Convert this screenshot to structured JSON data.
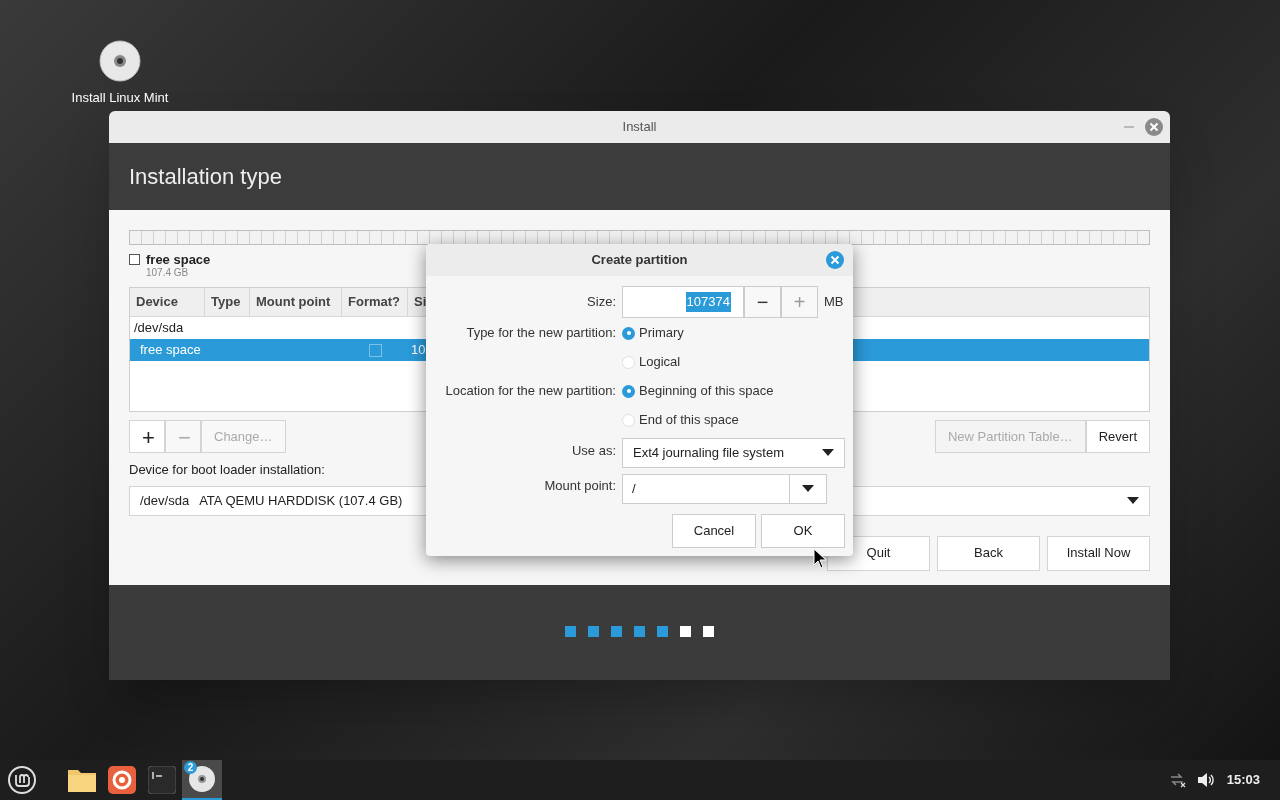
{
  "desktop_icons": [
    {
      "label": "Install Linux Mint"
    }
  ],
  "window": {
    "title": "Install",
    "heading": "Installation type",
    "partition_legend": [
      {
        "label": "free space",
        "size": "107.4 GB",
        "checked": false
      }
    ],
    "table": {
      "columns": [
        "Device",
        "Type",
        "Mount point",
        "Format?",
        "Si"
      ],
      "rows": [
        {
          "device": "/dev/sda",
          "selected": false
        },
        {
          "device": "free space",
          "format": false,
          "size": "10",
          "selected": true
        }
      ]
    },
    "table_buttons": [
      {
        "label": "+",
        "disabled": false
      },
      {
        "label": "−",
        "disabled": true
      },
      {
        "label": "Change…",
        "disabled": true
      }
    ],
    "table_buttons_right": [
      {
        "label": "New Partition Table…",
        "disabled": true
      },
      {
        "label": "Revert",
        "disabled": false
      }
    ],
    "boot_loader": {
      "label": "Device for boot loader installation:",
      "device": "/dev/sda",
      "description": "ATA QEMU HARDDISK (107.4 GB)"
    },
    "buttons": [
      "Quit",
      "Back",
      "Install Now"
    ],
    "progress_steps": [
      {
        "done": true
      },
      {
        "done": true
      },
      {
        "done": true
      },
      {
        "done": true
      },
      {
        "done": true
      },
      {
        "done": false
      },
      {
        "done": false
      }
    ]
  },
  "dialog": {
    "title": "Create partition",
    "size": {
      "label": "Size:",
      "value": "107374",
      "text_selected": true,
      "unit": "MB",
      "steppers": [
        {
          "label": "−",
          "disabled": false
        },
        {
          "label": "+",
          "disabled": true
        }
      ]
    },
    "type": {
      "label": "Type for the new partition:",
      "options": [
        {
          "label": "Primary",
          "selected": true
        },
        {
          "label": "Logical",
          "selected": false
        }
      ]
    },
    "location": {
      "label": "Location for the new partition:",
      "options": [
        {
          "label": "Beginning of this space",
          "selected": true
        },
        {
          "label": "End of this space",
          "selected": false
        }
      ]
    },
    "use_as": {
      "label": "Use as:",
      "value": "Ext4 journaling file system"
    },
    "mount_point": {
      "label": "Mount point:",
      "value": "/"
    },
    "buttons": [
      "Cancel",
      "OK"
    ]
  },
  "taskbar": {
    "apps": [
      {
        "kind": "menu",
        "active": false
      },
      {
        "kind": "files",
        "active": false
      },
      {
        "kind": "browser",
        "active": false
      },
      {
        "kind": "terminal",
        "active": false
      },
      {
        "kind": "installer",
        "badge": "2",
        "active": true
      }
    ],
    "clock": "15:03"
  }
}
